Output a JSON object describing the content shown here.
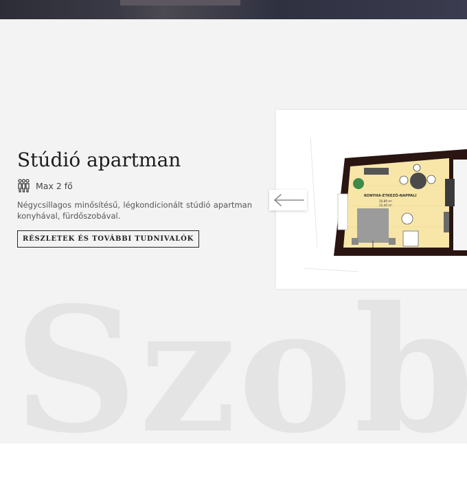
{
  "room": {
    "title": "Stúdió apartman",
    "capacity": "Max 2 fő",
    "description": "Négycsillagos minősítésű, légkondicionált stúdió apartman konyhával, fürdőszobával.",
    "details_button": "RÉSZLETEK ÉS TOVÁBBI TUDNIVALÓK"
  },
  "floorplan": {
    "room_label": "KONYHA-ÉTKEZŐ-NAPPALI",
    "area_1": "20,89 m²",
    "area_2": "22,40 m²",
    "prev_icon": "arrow-left-icon"
  },
  "section": {
    "watermark": "Szobák"
  },
  "colors": {
    "background": "#f3f3f3",
    "text": "#1d1d1d",
    "wall": "#2a1512",
    "floor": "#f7e6a8"
  }
}
